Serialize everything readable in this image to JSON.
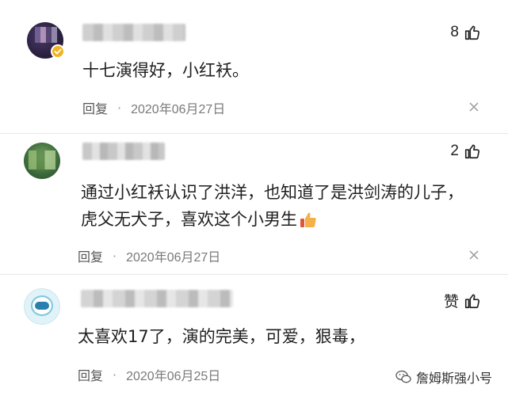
{
  "comments": [
    {
      "likes": "8",
      "text_lines": [
        "十七演得好，小红袄。"
      ],
      "reply_label": "回复",
      "separator": "·",
      "date": "2020年06月27日",
      "avatar_icon": "user-avatar-purple",
      "badge_icon": "verified-badge-icon"
    },
    {
      "likes": "2",
      "text_lines": [
        "通过小红袄认识了洪洋，也知道了是洪剑涛的儿子，",
        "虎父无犬子，喜欢这个小男生"
      ],
      "emoji": "thumbs-up-emoji",
      "reply_label": "回复",
      "separator": "·",
      "date": "2020年06月27日",
      "avatar_icon": "user-avatar-green"
    },
    {
      "likes": "赞",
      "text_lines": [
        "太喜欢17了，演的完美，可爱，狠毒，"
      ],
      "reply_label": "回复",
      "separator": "·",
      "date": "2020年06月25日",
      "avatar_icon": "user-avatar-astronaut"
    }
  ],
  "watermark": {
    "text": "詹姆斯强小号",
    "icon": "wechat-icon"
  },
  "colors": {
    "text": "#1f1f1f",
    "meta": "#6f6f6f",
    "divider": "#e6e6e6",
    "badge": "#f2b321"
  }
}
